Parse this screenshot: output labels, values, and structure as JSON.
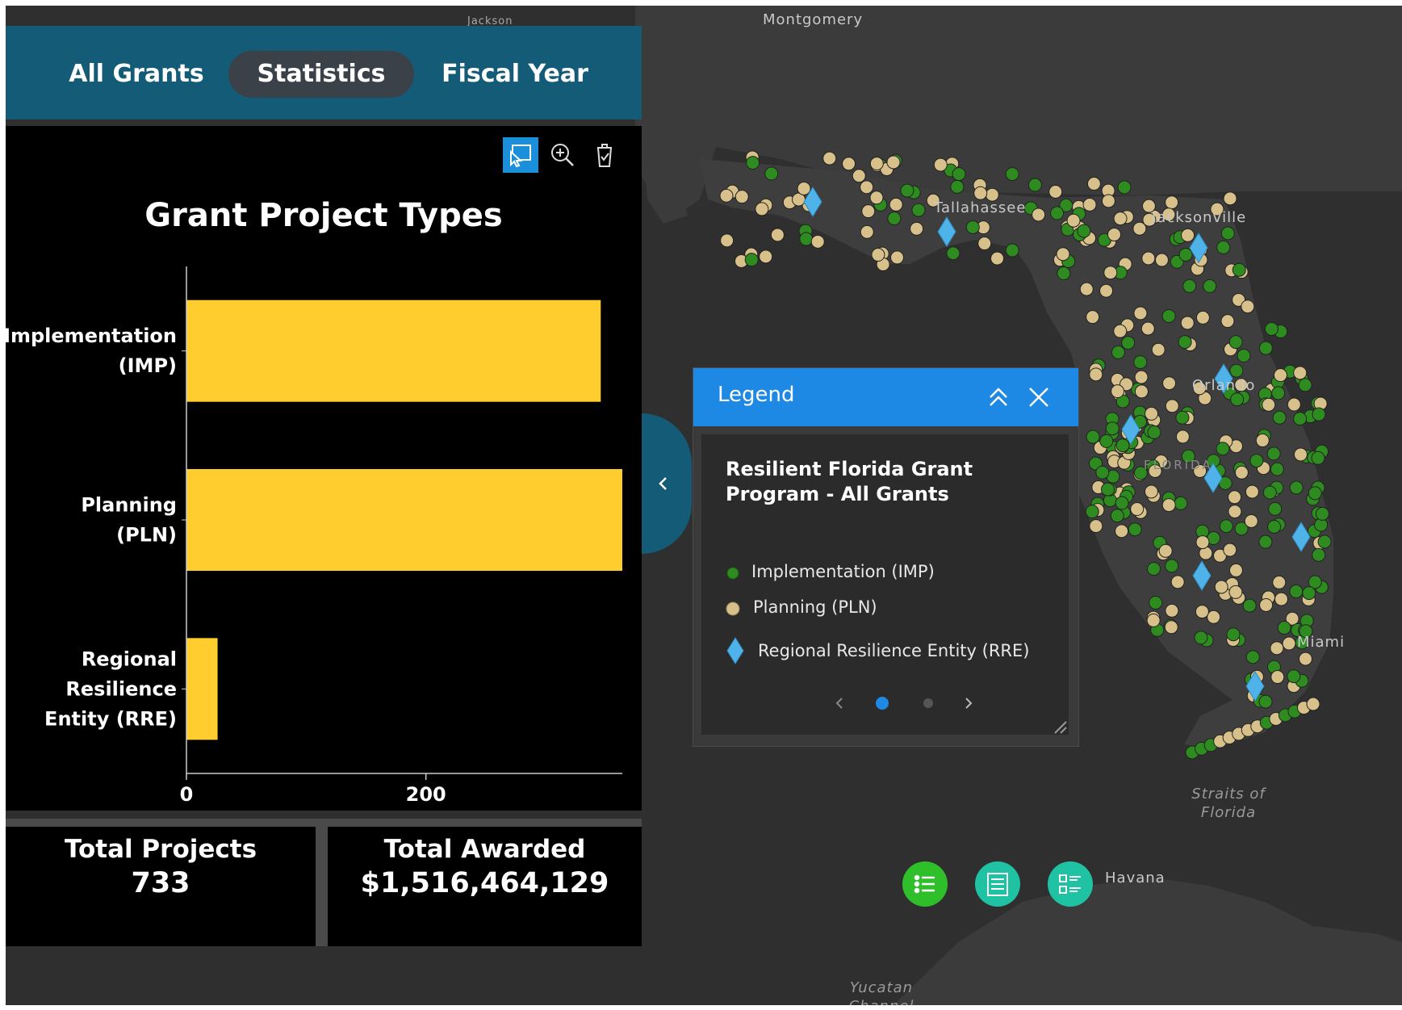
{
  "tabs": [
    {
      "label": "All Grants",
      "active": false
    },
    {
      "label": "Statistics",
      "active": true
    },
    {
      "label": "Fiscal Year",
      "active": false
    }
  ],
  "toolbar": {
    "icons": [
      "select-icon",
      "zoom-in-icon",
      "clear-selection-icon"
    ]
  },
  "chart_data": {
    "type": "bar",
    "orientation": "horizontal",
    "title": "Grant Project Types",
    "categories": [
      "Implementation (IMP)",
      "Planning (PLN)",
      "Regional Resilience Entity (RRE)"
    ],
    "category_lines": [
      [
        "Implementation",
        "(IMP)"
      ],
      [
        "Planning",
        "(PLN)"
      ],
      [
        "Regional",
        "Resilience",
        "Entity (RRE)"
      ]
    ],
    "values": [
      346,
      364,
      26
    ],
    "xticks": [
      0,
      200
    ],
    "xlim": [
      0,
      364
    ],
    "bar_color": "#ffce2e",
    "grid": false
  },
  "stats": {
    "total_projects_label": "Total Projects",
    "total_projects_value": "733",
    "total_awarded_label": "Total Awarded",
    "total_awarded_value": "$1,516,464,129"
  },
  "legend": {
    "title": "Legend",
    "layer_title": "Resilient Florida Grant Program - All Grants",
    "items": [
      {
        "label": "Implementation (IMP)",
        "symbol": "circle",
        "color": "#2e8b1f"
      },
      {
        "label": "Planning (PLN)",
        "symbol": "circle",
        "color": "#d8c08a"
      },
      {
        "label": "Regional Resilience Entity (RRE)",
        "symbol": "diamond",
        "color": "#4fb3ea"
      }
    ],
    "page": 1,
    "pages": 2
  },
  "map": {
    "labels": {
      "montgomery": "Montgomery",
      "jackson": "Jackson",
      "tallahassee": "Tallahassee",
      "jacksonville": "Jacksonville",
      "orlando": "Orlando",
      "florida": "FLORIDA",
      "miami": "Miami",
      "havana": "Havana",
      "straits": "Straits of Florida",
      "yucatan": "Yucatan Channel"
    }
  },
  "colors": {
    "tabbar": "#145b77",
    "legend_header": "#1e88e5",
    "map_background": "#2f2f2f",
    "land": "#3d3d3d",
    "implementation": "#2e8b1f",
    "planning": "#d8c08a",
    "rre": "#4fb3ea"
  },
  "fabs": [
    {
      "name": "list-icon",
      "color": "#2fbf2a"
    },
    {
      "name": "table-icon",
      "color": "#1fc2a3"
    },
    {
      "name": "legend-list-icon",
      "color": "#1fc2a3"
    }
  ]
}
